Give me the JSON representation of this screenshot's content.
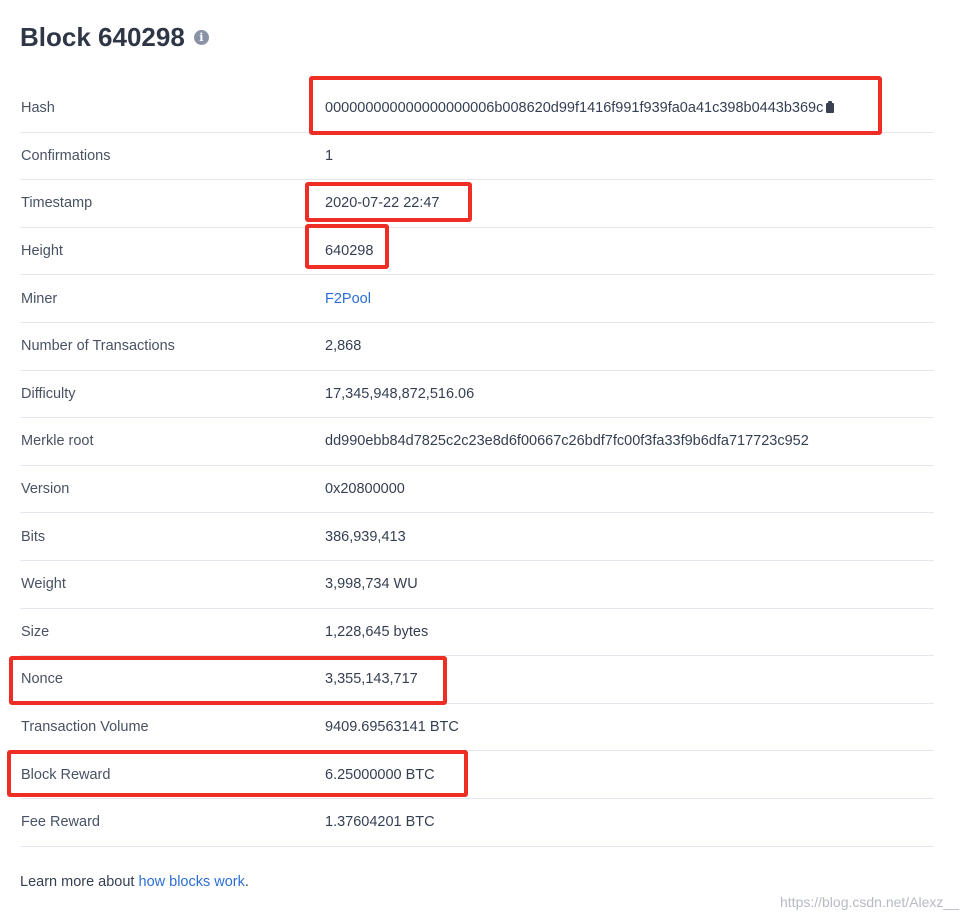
{
  "header": {
    "title": "Block 640298",
    "info_icon": "info-icon"
  },
  "details": [
    {
      "key": "hash",
      "label": "Hash",
      "value": "000000000000000000006b008620d99f1416f991f939fa0a41c398b0443b369c",
      "copy_icon": "clipboard-icon"
    },
    {
      "key": "confirmations",
      "label": "Confirmations",
      "value": "1"
    },
    {
      "key": "timestamp",
      "label": "Timestamp",
      "value": "2020-07-22 22:47"
    },
    {
      "key": "height",
      "label": "Height",
      "value": "640298"
    },
    {
      "key": "miner",
      "label": "Miner",
      "value": "F2Pool",
      "is_link": true
    },
    {
      "key": "tx_count",
      "label": "Number of Transactions",
      "value": "2,868"
    },
    {
      "key": "difficulty",
      "label": "Difficulty",
      "value": "17,345,948,872,516.06"
    },
    {
      "key": "merkle_root",
      "label": "Merkle root",
      "value": "dd990ebb84d7825c2c23e8d6f00667c26bdf7fc00f3fa33f9b6dfa717723c952"
    },
    {
      "key": "version",
      "label": "Version",
      "value": "0x20800000"
    },
    {
      "key": "bits",
      "label": "Bits",
      "value": "386,939,413"
    },
    {
      "key": "weight",
      "label": "Weight",
      "value": "3,998,734 WU"
    },
    {
      "key": "size",
      "label": "Size",
      "value": "1,228,645 bytes"
    },
    {
      "key": "nonce",
      "label": "Nonce",
      "value": "3,355,143,717"
    },
    {
      "key": "tx_volume",
      "label": "Transaction Volume",
      "value": "9409.69563141 BTC"
    },
    {
      "key": "block_reward",
      "label": "Block Reward",
      "value": "6.25000000 BTC"
    },
    {
      "key": "fee_reward",
      "label": "Fee Reward",
      "value": "1.37604201 BTC"
    }
  ],
  "footer": {
    "prefix": "Learn more about ",
    "link_text": "how blocks work",
    "suffix": "."
  },
  "watermark": "https://blog.csdn.net/Alexz__",
  "colors": {
    "highlight": "#ee2d24",
    "link": "#2d6ed6",
    "divider": "#e4e7ed"
  }
}
